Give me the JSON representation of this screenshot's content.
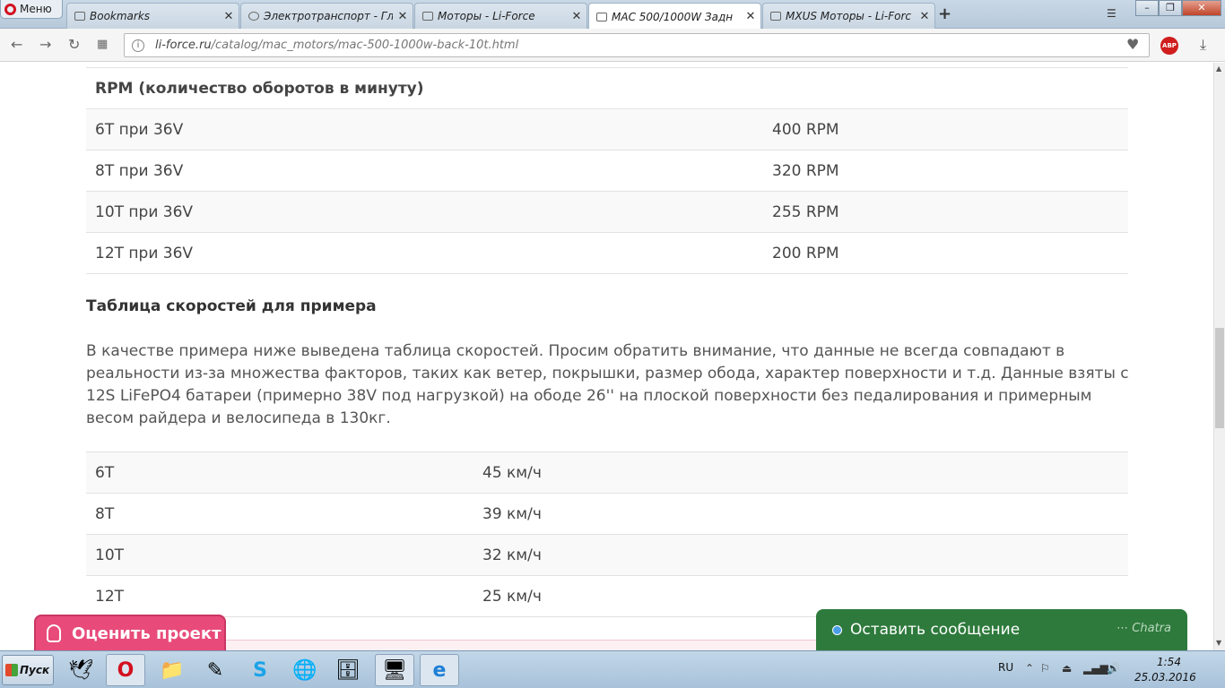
{
  "browser": {
    "menu_label": "Меню",
    "tabs": [
      {
        "title": "Bookmarks",
        "active": false
      },
      {
        "title": "Электротранспорт - Гл",
        "active": false
      },
      {
        "title": "Моторы - Li-Force",
        "active": false
      },
      {
        "title": "MAC 500/1000W Задн",
        "active": true
      },
      {
        "title": "MXUS Моторы - Li-Forc",
        "active": false
      }
    ],
    "new_tab": "+",
    "close_glyph": "✕",
    "url_domain": "li-force.ru",
    "url_path": "/catalog/mac_motors/mac-500-1000w-back-10t.html",
    "abp_label": "ABP"
  },
  "page": {
    "rpm_table": {
      "heading": "RPM (количество оборотов в минуту)",
      "rows": [
        {
          "winding": "6T при 36V",
          "value": "400 RPM"
        },
        {
          "winding": "8T при 36V",
          "value": "320 RPM"
        },
        {
          "winding": "10T при 36V",
          "value": "255 RPM"
        },
        {
          "winding": "12T при 36V",
          "value": "200 RPM"
        }
      ]
    },
    "speed_section_title": "Таблица скоростей для примера",
    "speed_section_text": "В качестве примера ниже выведена таблица скоростей. Просим обратить внимание, что данные не всегда совпадают в реальности из-за множества факторов, таких как ветер, покрышки, размер обода, характер поверхности и т.д. Данные взяты с 12S LiFePO4 батареи (примерно 38V под нагрузкой) на ободе 26'' на плоской поверхности без педалирования и примерным весом райдера и велосипеда в 130кг.",
    "speed_table": [
      {
        "winding": "6T",
        "speed": "45 км/ч"
      },
      {
        "winding": "8T",
        "speed": "39 км/ч"
      },
      {
        "winding": "10T",
        "speed": "32 км/ч"
      },
      {
        "winding": "12T",
        "speed": "25 км/ч"
      }
    ],
    "rate_button": "Оценить проект",
    "chat_button": "Оставить сообщение",
    "chat_brand": "⋯ Chatra"
  },
  "taskbar": {
    "start_label": "Пуск",
    "lang": "RU",
    "time": "1:54",
    "date": "25.03.2016"
  },
  "colors": {
    "rate_button": "#e84b7a",
    "chat_button": "#2e7a3c",
    "tab_bar": "#c9d8e6"
  }
}
